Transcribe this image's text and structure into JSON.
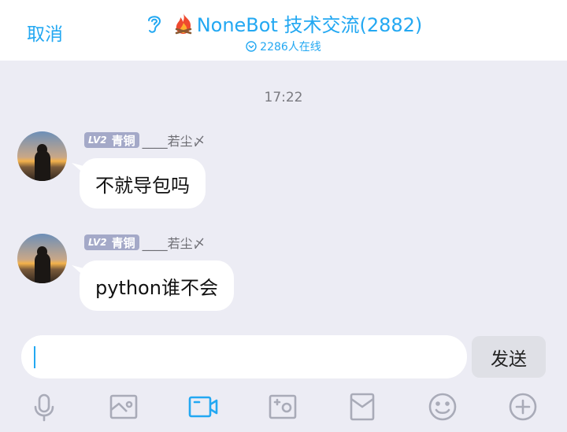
{
  "header": {
    "cancel_label": "取消",
    "group_name": "NoneBot 技术交流(2882)",
    "online_text": "2286人在线"
  },
  "chat": {
    "timestamp": "17:22",
    "messages": [
      {
        "level": "LV2",
        "rank": "青铜",
        "nickname": "____若尘〆",
        "text": "不就导包吗"
      },
      {
        "level": "LV2",
        "rank": "青铜",
        "nickname": "____若尘〆",
        "text": "python谁不会"
      }
    ]
  },
  "input": {
    "value": "",
    "send_label": "发送"
  },
  "toolbar": {
    "icons": [
      "microphone-icon",
      "image-icon",
      "video-icon",
      "camera-icon",
      "red-packet-icon",
      "emoji-icon",
      "plus-icon"
    ],
    "active": "video-icon"
  },
  "colors": {
    "accent": "#23a8f2",
    "background": "#ececf4",
    "badge": "#a4a9c8",
    "icon": "#a9abb8"
  }
}
